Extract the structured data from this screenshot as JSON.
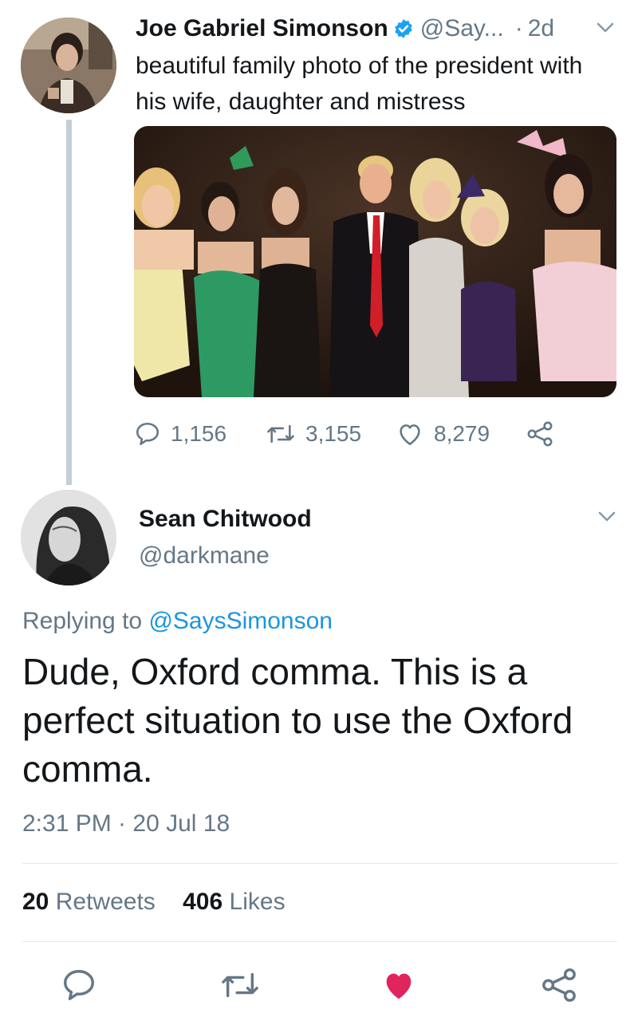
{
  "original_tweet": {
    "author_name": "Joe Gabriel Simonson",
    "handle": "@Say...",
    "separator": "·",
    "age": "2d",
    "text": "beautiful family photo of the president with his wife, daughter and mistress",
    "replies": "1,156",
    "retweets": "3,155",
    "likes": "8,279"
  },
  "reply_tweet": {
    "author_name": "Sean Chitwood",
    "handle": "@darkmane",
    "replying_prefix": "Replying to",
    "replying_to": "@SaysSimonson",
    "text": "Dude, Oxford comma. This is a perfect situation to use the Oxford comma.",
    "timestamp": "2:31 PM · 20 Jul 18",
    "retweet_count": "20",
    "retweet_label": "Retweets",
    "like_count": "406",
    "like_label": "Likes"
  },
  "colors": {
    "text_primary": "#14171a",
    "text_secondary": "#657786",
    "link": "#1b95e0",
    "verified": "#1da1f2",
    "like_active": "#e0245e",
    "divider": "#e1e8ed",
    "thread_line": "#c4ced6"
  },
  "icons": {
    "verified": "verified-badge-icon",
    "reply": "reply-icon",
    "retweet": "retweet-icon",
    "like": "heart-icon",
    "share": "share-icon",
    "caret": "chevron-down-icon"
  },
  "bottom_actions": {
    "like_active": true
  }
}
